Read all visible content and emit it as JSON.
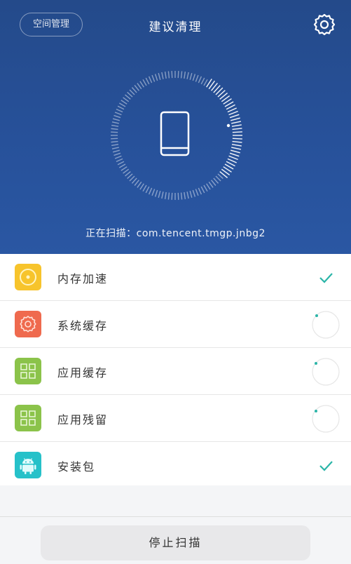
{
  "header": {
    "space_button": "空间管理",
    "title": "建议清理",
    "settings_icon": "gear-icon"
  },
  "scan": {
    "prefix": "正在扫描：",
    "package": "com.tencent.tmgp.jnbg2",
    "icon": "phone-icon"
  },
  "items": [
    {
      "label": "内存加速",
      "icon": "disc-icon",
      "color": "#f7c42c",
      "status": "done"
    },
    {
      "label": "系统缓存",
      "icon": "gear-icon",
      "color": "#ef6a4e",
      "status": "scanning"
    },
    {
      "label": "应用缓存",
      "icon": "apps-grid-icon",
      "color": "#8bc34a",
      "status": "scanning"
    },
    {
      "label": "应用残留",
      "icon": "apps-grid-icon",
      "color": "#8bc34a",
      "status": "scanning"
    },
    {
      "label": "安装包",
      "icon": "android-icon",
      "color": "#26c1c9",
      "status": "done"
    }
  ],
  "footer": {
    "stop_button": "停止扫描"
  },
  "colors": {
    "header_bg": "#27519a",
    "check": "#2bb5a8"
  }
}
